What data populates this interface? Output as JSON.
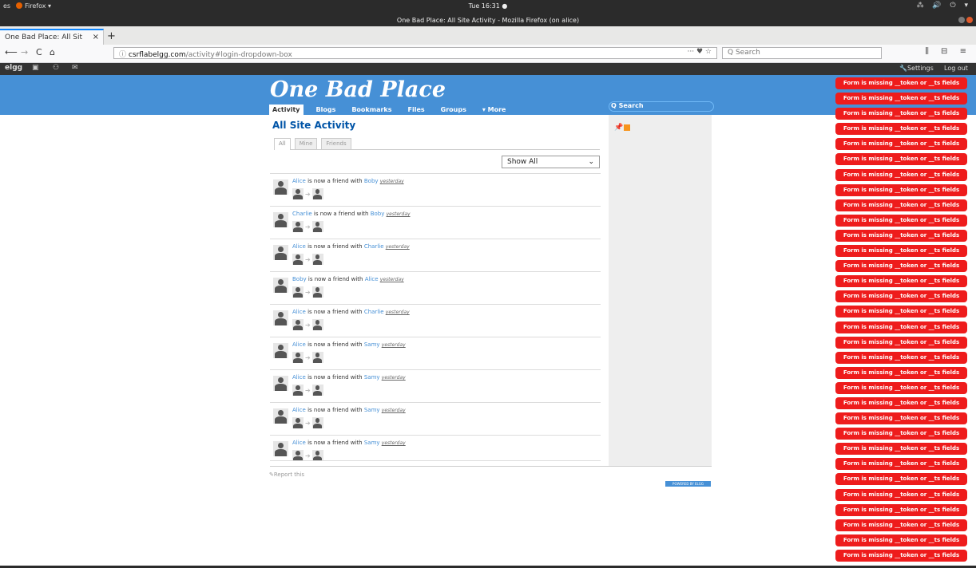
{
  "system": {
    "activities": "es",
    "app_menu": "Firefox ▾",
    "clock": "Tue 16:31 ●",
    "window_title": "One Bad Place: All Site Activity - Mozilla Firefox (on alice)",
    "tray": "⁂ 🔊 ⏻ ▾"
  },
  "browser": {
    "tab_title": "One Bad Place: All Sit",
    "tab_close": "×",
    "new_tab": "+",
    "back": "⟵",
    "forward": "→",
    "reload": "C",
    "home": "⌂",
    "url_host": "csrflabelgg.com",
    "url_path": "/activity#login-dropdown-box",
    "page_actions": "··· ♥ ☆",
    "search_placeholder": "Q Search",
    "toolbar_right": "⫼ ⊟ ≡"
  },
  "elgg_topbar": {
    "logo": "elgg",
    "settings": "Settings",
    "logout": "Log out"
  },
  "site": {
    "name": "One Bad Place",
    "search": "Q Search",
    "menu": [
      "Activity",
      "Blogs",
      "Bookmarks",
      "Files",
      "Groups",
      "▾ More"
    ]
  },
  "activity": {
    "title": "All Site Activity",
    "tabs": [
      "All",
      "Mine",
      "Friends"
    ],
    "filter": "Show All",
    "items": [
      {
        "subject": "Alice",
        "verb": " is now a friend with ",
        "object": "Boby",
        "time": "yesterday"
      },
      {
        "subject": "Charlie",
        "verb": " is now a friend with ",
        "object": "Boby",
        "time": "yesterday"
      },
      {
        "subject": "Alice",
        "verb": " is now a friend with ",
        "object": "Charlie",
        "time": "yesterday"
      },
      {
        "subject": "Boby",
        "verb": " is now a friend with ",
        "object": "Alice",
        "time": "yesterday"
      },
      {
        "subject": "Alice",
        "verb": " is now a friend with ",
        "object": "Charlie",
        "time": "yesterday"
      },
      {
        "subject": "Alice",
        "verb": " is now a friend with ",
        "object": "Samy",
        "time": "yesterday"
      },
      {
        "subject": "Alice",
        "verb": " is now a friend with ",
        "object": "Samy",
        "time": "yesterday"
      },
      {
        "subject": "Alice",
        "verb": " is now a friend with ",
        "object": "Samy",
        "time": "yesterday"
      },
      {
        "subject": "Alice",
        "verb": " is now a friend with ",
        "object": "Samy",
        "time": "yesterday"
      }
    ],
    "report": "Report this",
    "powered": "POWERED BY ELGG"
  },
  "errors": {
    "message": "Form is missing __token or __ts fields",
    "count": 32
  },
  "colors": {
    "header": "#4690d6",
    "error": "#ee1c1c",
    "link": "#4690d6"
  }
}
